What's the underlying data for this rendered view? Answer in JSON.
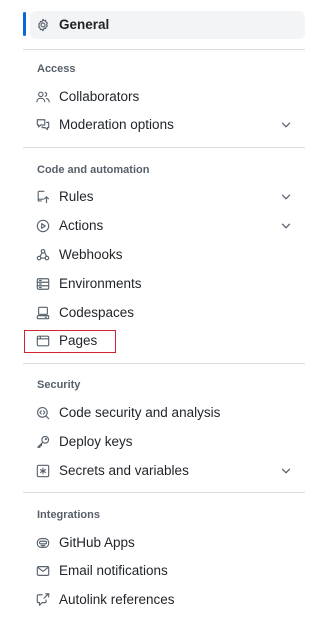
{
  "general": {
    "label": "General",
    "icon": "gear-icon"
  },
  "groups": {
    "access": {
      "heading": "Access",
      "items": [
        {
          "label": "Collaborators",
          "icon": "people-icon"
        },
        {
          "label": "Moderation options",
          "icon": "comment-discussion-icon",
          "expandable": true
        }
      ]
    },
    "code_automation": {
      "heading": "Code and automation",
      "items": [
        {
          "label": "Rules",
          "icon": "repo-push-icon",
          "expandable": true
        },
        {
          "label": "Actions",
          "icon": "play-icon",
          "expandable": true
        },
        {
          "label": "Webhooks",
          "icon": "webhook-icon"
        },
        {
          "label": "Environments",
          "icon": "server-icon"
        },
        {
          "label": "Codespaces",
          "icon": "codespaces-icon"
        },
        {
          "label": "Pages",
          "icon": "browser-icon",
          "highlighted": true
        }
      ]
    },
    "security": {
      "heading": "Security",
      "items": [
        {
          "label": "Code security and analysis",
          "icon": "codescan-icon"
        },
        {
          "label": "Deploy keys",
          "icon": "key-icon"
        },
        {
          "label": "Secrets and variables",
          "icon": "key-asterisk-icon",
          "expandable": true
        }
      ]
    },
    "integrations": {
      "heading": "Integrations",
      "items": [
        {
          "label": "GitHub Apps",
          "icon": "hubot-icon"
        },
        {
          "label": "Email notifications",
          "icon": "mail-icon"
        },
        {
          "label": "Autolink references",
          "icon": "cross-reference-icon"
        }
      ]
    }
  },
  "colors": {
    "accent": "#0969da",
    "highlight_border": "#d1242f",
    "active_background": "#f3f4f6",
    "heading_text": "#57606a"
  }
}
